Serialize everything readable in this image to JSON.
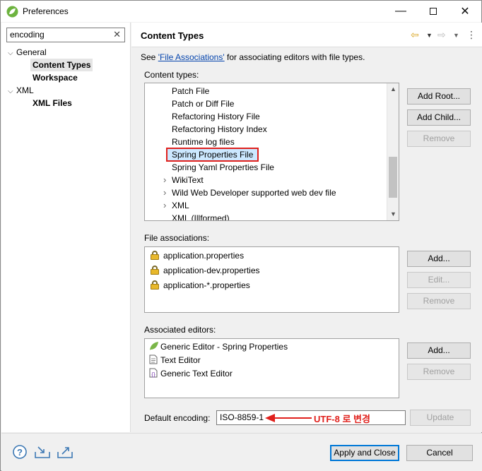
{
  "window": {
    "title": "Preferences",
    "controls": [
      "minimize",
      "maximize",
      "close"
    ]
  },
  "filter": {
    "value": "encoding"
  },
  "tree": [
    {
      "label": "General",
      "expanded": true,
      "children": [
        "Content Types",
        "Workspace"
      ]
    },
    {
      "label": "XML",
      "expanded": true,
      "children": [
        "XML Files"
      ]
    }
  ],
  "page": {
    "title": "Content Types",
    "description_prefix": "See ",
    "description_link": "'File Associations'",
    "description_suffix": " for associating editors with file types."
  },
  "content_types": {
    "label": "Content types:",
    "items": [
      {
        "label": "Patch File",
        "expandable": false
      },
      {
        "label": "Patch or Diff File",
        "expandable": false
      },
      {
        "label": "Refactoring History File",
        "expandable": false
      },
      {
        "label": "Refactoring History Index",
        "expandable": false
      },
      {
        "label": "Runtime log files",
        "expandable": false
      },
      {
        "label": "Spring Properties File",
        "expandable": false,
        "selected": true
      },
      {
        "label": "Spring Yaml Properties File",
        "expandable": false
      },
      {
        "label": "WikiText",
        "expandable": true
      },
      {
        "label": "Wild Web Developer supported web dev file",
        "expandable": true
      },
      {
        "label": "XML",
        "expandable": true
      },
      {
        "label": "XML (Illformed)",
        "expandable": false
      }
    ],
    "buttons": {
      "add_root": "Add Root...",
      "add_child": "Add Child...",
      "remove": "Remove"
    }
  },
  "file_associations": {
    "label": "File associations:",
    "items": [
      "application.properties",
      "application-dev.properties",
      "application-*.properties"
    ],
    "buttons": {
      "add": "Add...",
      "edit": "Edit...",
      "remove": "Remove"
    }
  },
  "associated_editors": {
    "label": "Associated editors:",
    "items": [
      {
        "label": "Generic Editor - Spring Properties",
        "icon": "spring-leaf-icon"
      },
      {
        "label": "Text Editor",
        "icon": "text-file-icon"
      },
      {
        "label": "Generic Text Editor",
        "icon": "generic-editor-icon"
      }
    ],
    "buttons": {
      "add": "Add...",
      "remove": "Remove"
    }
  },
  "encoding": {
    "label": "Default encoding:",
    "value": "ISO-8859-1",
    "annotation": "UTF-8 로 변경",
    "update": "Update"
  },
  "footer": {
    "apply_close": "Apply and Close",
    "cancel": "Cancel"
  },
  "colors": {
    "accent": "#0078d7",
    "annotation": "#e0201c",
    "selection": "#cce8ff",
    "link": "#0645ad"
  }
}
